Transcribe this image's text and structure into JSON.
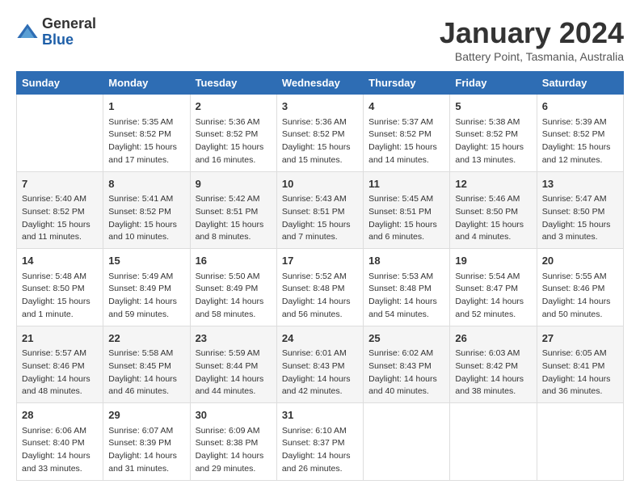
{
  "header": {
    "logo_general": "General",
    "logo_blue": "Blue",
    "month_title": "January 2024",
    "location": "Battery Point, Tasmania, Australia"
  },
  "days_of_week": [
    "Sunday",
    "Monday",
    "Tuesday",
    "Wednesday",
    "Thursday",
    "Friday",
    "Saturday"
  ],
  "weeks": [
    [
      {
        "day": "",
        "info": ""
      },
      {
        "day": "1",
        "info": "Sunrise: 5:35 AM\nSunset: 8:52 PM\nDaylight: 15 hours\nand 17 minutes."
      },
      {
        "day": "2",
        "info": "Sunrise: 5:36 AM\nSunset: 8:52 PM\nDaylight: 15 hours\nand 16 minutes."
      },
      {
        "day": "3",
        "info": "Sunrise: 5:36 AM\nSunset: 8:52 PM\nDaylight: 15 hours\nand 15 minutes."
      },
      {
        "day": "4",
        "info": "Sunrise: 5:37 AM\nSunset: 8:52 PM\nDaylight: 15 hours\nand 14 minutes."
      },
      {
        "day": "5",
        "info": "Sunrise: 5:38 AM\nSunset: 8:52 PM\nDaylight: 15 hours\nand 13 minutes."
      },
      {
        "day": "6",
        "info": "Sunrise: 5:39 AM\nSunset: 8:52 PM\nDaylight: 15 hours\nand 12 minutes."
      }
    ],
    [
      {
        "day": "7",
        "info": "Sunrise: 5:40 AM\nSunset: 8:52 PM\nDaylight: 15 hours\nand 11 minutes."
      },
      {
        "day": "8",
        "info": "Sunrise: 5:41 AM\nSunset: 8:52 PM\nDaylight: 15 hours\nand 10 minutes."
      },
      {
        "day": "9",
        "info": "Sunrise: 5:42 AM\nSunset: 8:51 PM\nDaylight: 15 hours\nand 8 minutes."
      },
      {
        "day": "10",
        "info": "Sunrise: 5:43 AM\nSunset: 8:51 PM\nDaylight: 15 hours\nand 7 minutes."
      },
      {
        "day": "11",
        "info": "Sunrise: 5:45 AM\nSunset: 8:51 PM\nDaylight: 15 hours\nand 6 minutes."
      },
      {
        "day": "12",
        "info": "Sunrise: 5:46 AM\nSunset: 8:50 PM\nDaylight: 15 hours\nand 4 minutes."
      },
      {
        "day": "13",
        "info": "Sunrise: 5:47 AM\nSunset: 8:50 PM\nDaylight: 15 hours\nand 3 minutes."
      }
    ],
    [
      {
        "day": "14",
        "info": "Sunrise: 5:48 AM\nSunset: 8:50 PM\nDaylight: 15 hours\nand 1 minute."
      },
      {
        "day": "15",
        "info": "Sunrise: 5:49 AM\nSunset: 8:49 PM\nDaylight: 14 hours\nand 59 minutes."
      },
      {
        "day": "16",
        "info": "Sunrise: 5:50 AM\nSunset: 8:49 PM\nDaylight: 14 hours\nand 58 minutes."
      },
      {
        "day": "17",
        "info": "Sunrise: 5:52 AM\nSunset: 8:48 PM\nDaylight: 14 hours\nand 56 minutes."
      },
      {
        "day": "18",
        "info": "Sunrise: 5:53 AM\nSunset: 8:48 PM\nDaylight: 14 hours\nand 54 minutes."
      },
      {
        "day": "19",
        "info": "Sunrise: 5:54 AM\nSunset: 8:47 PM\nDaylight: 14 hours\nand 52 minutes."
      },
      {
        "day": "20",
        "info": "Sunrise: 5:55 AM\nSunset: 8:46 PM\nDaylight: 14 hours\nand 50 minutes."
      }
    ],
    [
      {
        "day": "21",
        "info": "Sunrise: 5:57 AM\nSunset: 8:46 PM\nDaylight: 14 hours\nand 48 minutes."
      },
      {
        "day": "22",
        "info": "Sunrise: 5:58 AM\nSunset: 8:45 PM\nDaylight: 14 hours\nand 46 minutes."
      },
      {
        "day": "23",
        "info": "Sunrise: 5:59 AM\nSunset: 8:44 PM\nDaylight: 14 hours\nand 44 minutes."
      },
      {
        "day": "24",
        "info": "Sunrise: 6:01 AM\nSunset: 8:43 PM\nDaylight: 14 hours\nand 42 minutes."
      },
      {
        "day": "25",
        "info": "Sunrise: 6:02 AM\nSunset: 8:43 PM\nDaylight: 14 hours\nand 40 minutes."
      },
      {
        "day": "26",
        "info": "Sunrise: 6:03 AM\nSunset: 8:42 PM\nDaylight: 14 hours\nand 38 minutes."
      },
      {
        "day": "27",
        "info": "Sunrise: 6:05 AM\nSunset: 8:41 PM\nDaylight: 14 hours\nand 36 minutes."
      }
    ],
    [
      {
        "day": "28",
        "info": "Sunrise: 6:06 AM\nSunset: 8:40 PM\nDaylight: 14 hours\nand 33 minutes."
      },
      {
        "day": "29",
        "info": "Sunrise: 6:07 AM\nSunset: 8:39 PM\nDaylight: 14 hours\nand 31 minutes."
      },
      {
        "day": "30",
        "info": "Sunrise: 6:09 AM\nSunset: 8:38 PM\nDaylight: 14 hours\nand 29 minutes."
      },
      {
        "day": "31",
        "info": "Sunrise: 6:10 AM\nSunset: 8:37 PM\nDaylight: 14 hours\nand 26 minutes."
      },
      {
        "day": "",
        "info": ""
      },
      {
        "day": "",
        "info": ""
      },
      {
        "day": "",
        "info": ""
      }
    ]
  ]
}
